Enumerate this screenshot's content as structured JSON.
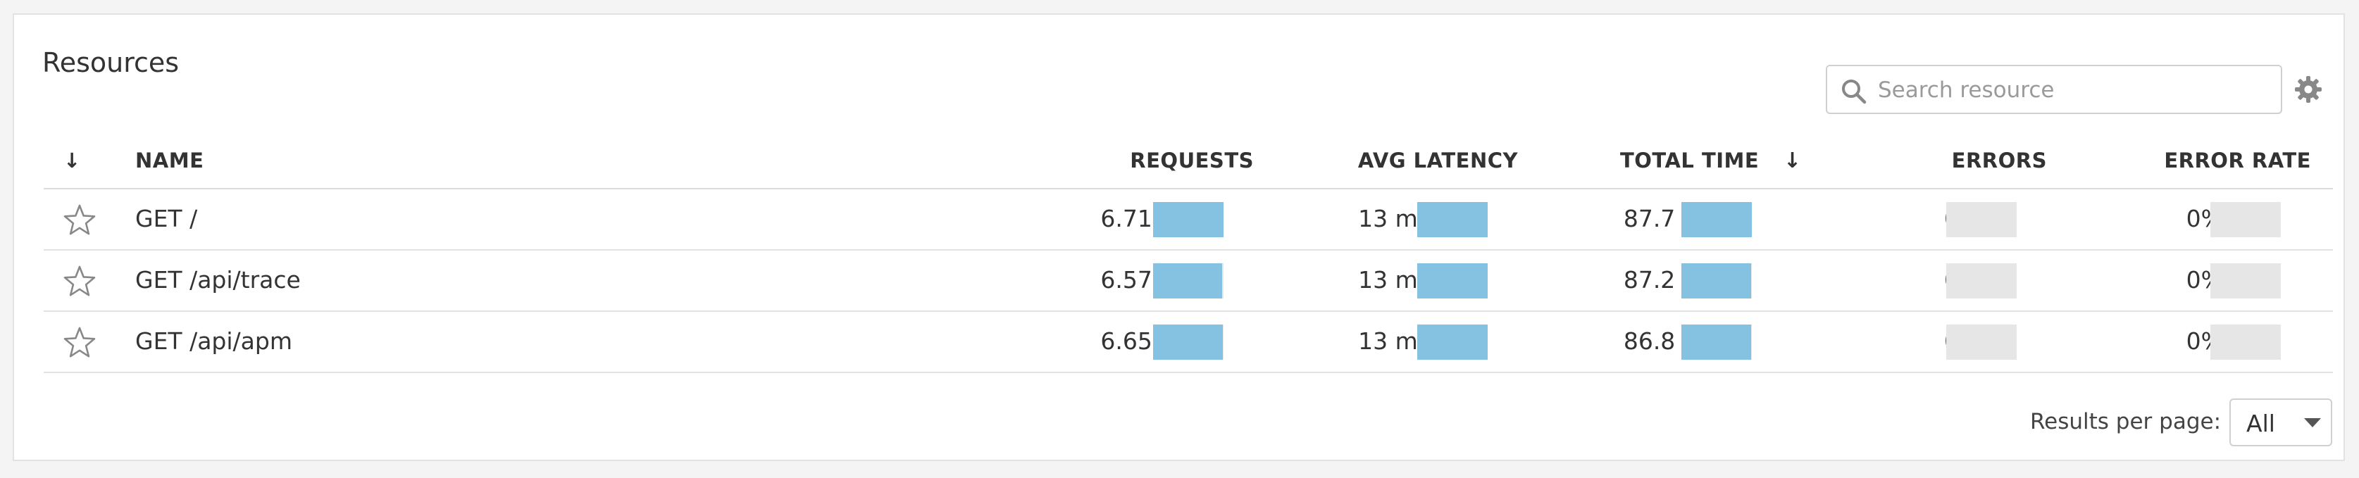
{
  "panel": {
    "title": "Resources"
  },
  "search": {
    "placeholder": "Search resource",
    "icon": "search-icon"
  },
  "settings": {
    "icon": "gear-icon"
  },
  "columns": {
    "sort_toggle": "↓",
    "name": "NAME",
    "requests": "REQUESTS",
    "avg_latency": "AVG LATENCY",
    "total_time": "TOTAL TIME",
    "total_time_sort": "↓",
    "errors": "ERRORS",
    "error_rate": "ERROR RATE"
  },
  "rows": [
    {
      "name": "GET /",
      "requests": "6.71k",
      "requests_fill": 1.0,
      "avg_latency": "13 ms",
      "avg_latency_fill": 1.0,
      "total_time": "87.7 s",
      "total_time_fill": 1.0,
      "errors": "0",
      "errors_fill": 0,
      "error_rate": "0%",
      "error_rate_fill": 0
    },
    {
      "name": "GET /api/trace",
      "requests": "6.57k",
      "requests_fill": 0.98,
      "avg_latency": "13 ms",
      "avg_latency_fill": 1.0,
      "total_time": "87.2 s",
      "total_time_fill": 0.99,
      "errors": "0",
      "errors_fill": 0,
      "error_rate": "0%",
      "error_rate_fill": 0
    },
    {
      "name": "GET /api/apm",
      "requests": "6.65k",
      "requests_fill": 0.99,
      "avg_latency": "13 ms",
      "avg_latency_fill": 1.0,
      "total_time": "86.8 s",
      "total_time_fill": 0.99,
      "errors": "0",
      "errors_fill": 0,
      "error_rate": "0%",
      "error_rate_fill": 0
    }
  ],
  "footer": {
    "results_label": "Results per page:",
    "results_value": "All"
  },
  "colors": {
    "bar_fill": "#85c1e1",
    "bar_empty": "#e6e6e6",
    "icon": "#888888"
  }
}
